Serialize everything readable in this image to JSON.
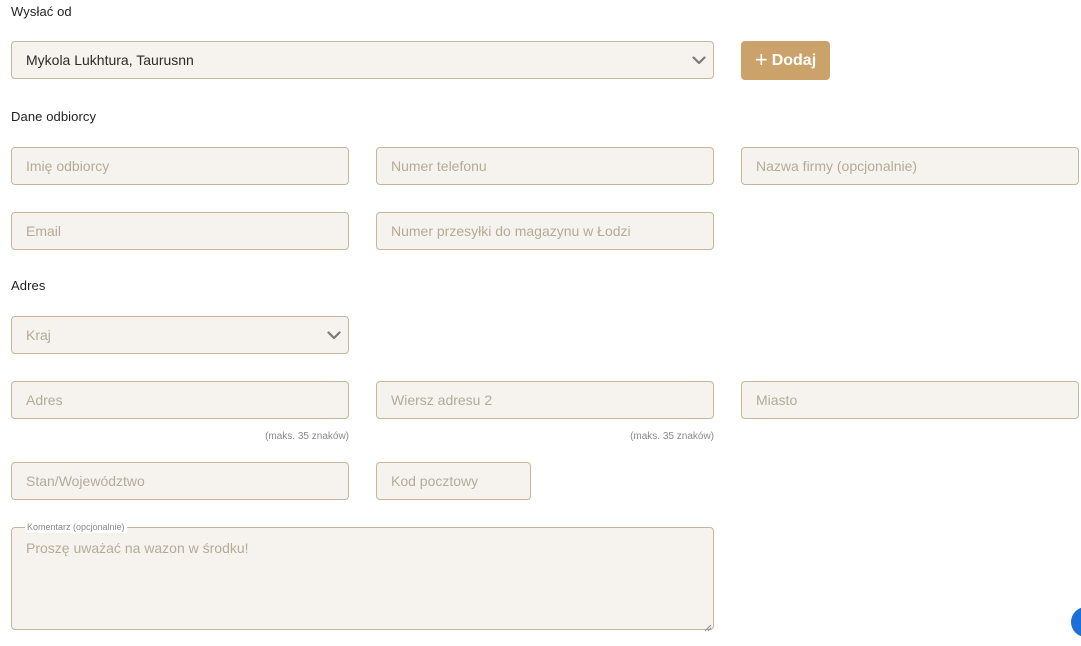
{
  "sender": {
    "label": "Wysłać od",
    "selected": "Mykola Lukhtura, Taurusnn",
    "add_button_label": "Dodaj"
  },
  "recipient": {
    "label": "Dane odbiorcy",
    "name_placeholder": "Imię odbiorcy",
    "phone_placeholder": "Numer telefonu",
    "company_placeholder": "Nazwa firmy (opcjonalnie)",
    "email_placeholder": "Email",
    "shipment_placeholder": "Numer przesyłki do magazynu w Łodzi"
  },
  "address": {
    "label": "Adres",
    "country_placeholder": "Kraj",
    "address1_placeholder": "Adres",
    "address2_placeholder": "Wiersz adresu 2",
    "city_placeholder": "Miasto",
    "address1_hint": "(maks. 35 znaków)",
    "address2_hint": "(maks. 35 znaków)",
    "state_placeholder": "Stan/Województwo",
    "postal_placeholder": "Kod pocztowy"
  },
  "comment": {
    "legend": "Komentarz (opcjonalnie)",
    "placeholder": "Proszę uważać na wazon w środku!"
  },
  "icons": {
    "chevron": "chevron-down-icon",
    "plus": "plus-icon",
    "chat": "chat-icon"
  },
  "colors": {
    "accent": "#cba36a",
    "field_bg": "#f6f3ee",
    "field_border": "#c7b69a",
    "fab": "#1b6fd6"
  }
}
